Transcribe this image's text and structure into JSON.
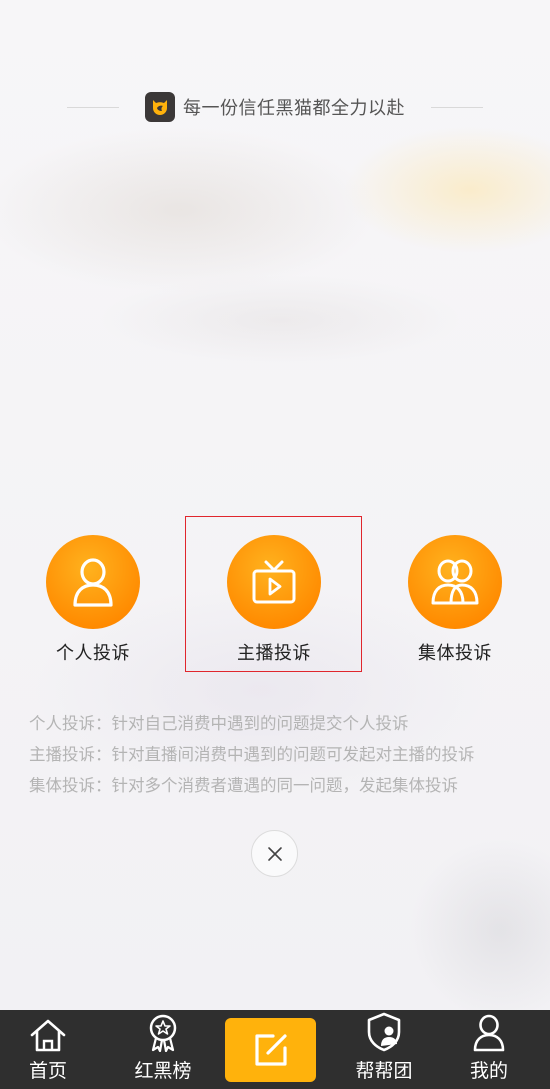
{
  "header": {
    "slogan": "每一份信任黑猫都全力以赴",
    "logo_icon": "black-cat-logo-icon"
  },
  "complaint_types": [
    {
      "label": "个人投诉",
      "icon": "person-icon"
    },
    {
      "label": "主播投诉",
      "icon": "tv-play-icon"
    },
    {
      "label": "集体投诉",
      "icon": "group-icon"
    }
  ],
  "descriptions": [
    "个人投诉：针对自己消费中遇到的问题提交个人投诉",
    "主播投诉：针对直播间消费中遇到的问题可发起对主播的投诉",
    "集体投诉：针对多个消费者遭遇的同一问题，发起集体投诉"
  ],
  "close_icon": "close-icon",
  "tabbar": {
    "items": [
      {
        "label": "首页",
        "icon": "home-icon"
      },
      {
        "label": "红黑榜",
        "icon": "medal-icon"
      },
      {
        "label": "",
        "icon": "edit-icon"
      },
      {
        "label": "帮帮团",
        "icon": "shield-user-icon"
      },
      {
        "label": "我的",
        "icon": "user-icon"
      }
    ]
  },
  "colors": {
    "accent_orange": "#ff9c0f",
    "highlight_border": "#e0262d",
    "tabbar_bg": "#2f2f2f",
    "post_button": "#ffb20c"
  }
}
